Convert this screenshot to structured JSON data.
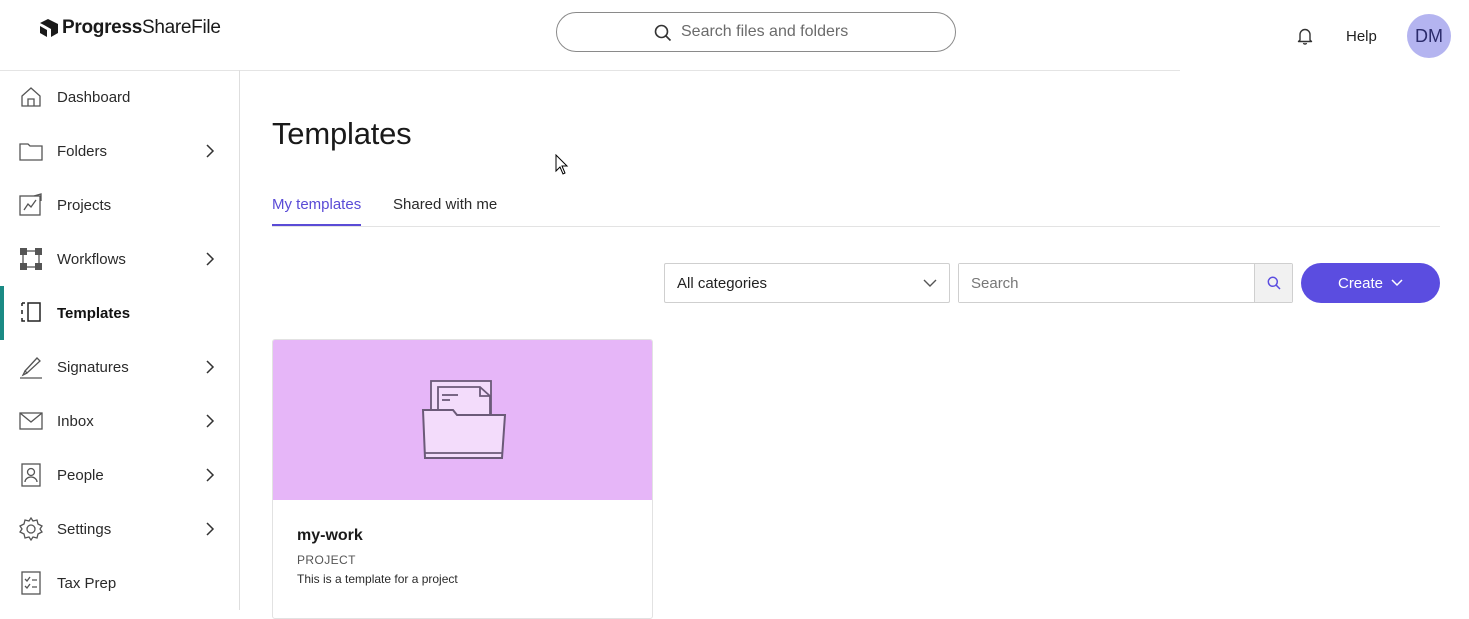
{
  "header": {
    "logo_brand": "Progress",
    "logo_product": "ShareFile",
    "search_placeholder": "Search files and folders",
    "help_label": "Help",
    "avatar_initials": "DM"
  },
  "sidebar": {
    "items": [
      {
        "label": "Dashboard",
        "icon": "home-icon",
        "has_chevron": false
      },
      {
        "label": "Folders",
        "icon": "folder-icon",
        "has_chevron": true
      },
      {
        "label": "Projects",
        "icon": "projects-icon",
        "has_chevron": false
      },
      {
        "label": "Workflows",
        "icon": "workflow-icon",
        "has_chevron": true
      },
      {
        "label": "Templates",
        "icon": "templates-icon",
        "has_chevron": false,
        "active": true
      },
      {
        "label": "Signatures",
        "icon": "signature-icon",
        "has_chevron": true
      },
      {
        "label": "Inbox",
        "icon": "mail-icon",
        "has_chevron": true
      },
      {
        "label": "People",
        "icon": "people-icon",
        "has_chevron": true
      },
      {
        "label": "Settings",
        "icon": "gear-icon",
        "has_chevron": true
      },
      {
        "label": "Tax Prep",
        "icon": "checklist-icon",
        "has_chevron": false
      }
    ]
  },
  "main": {
    "title": "Templates",
    "tabs": [
      {
        "label": "My templates",
        "active": true
      },
      {
        "label": "Shared with me",
        "active": false
      }
    ],
    "filters": {
      "category_selected": "All categories",
      "search_placeholder": "Search",
      "create_label": "Create"
    },
    "cards": [
      {
        "title": "my-work",
        "type": "PROJECT",
        "description": "This is a template for a project",
        "banner_color": "#e6b6f8"
      }
    ]
  },
  "colors": {
    "accent": "#5b4de0",
    "active_nav_bar": "#1a8a84",
    "avatar_bg": "#b4b4f0"
  }
}
